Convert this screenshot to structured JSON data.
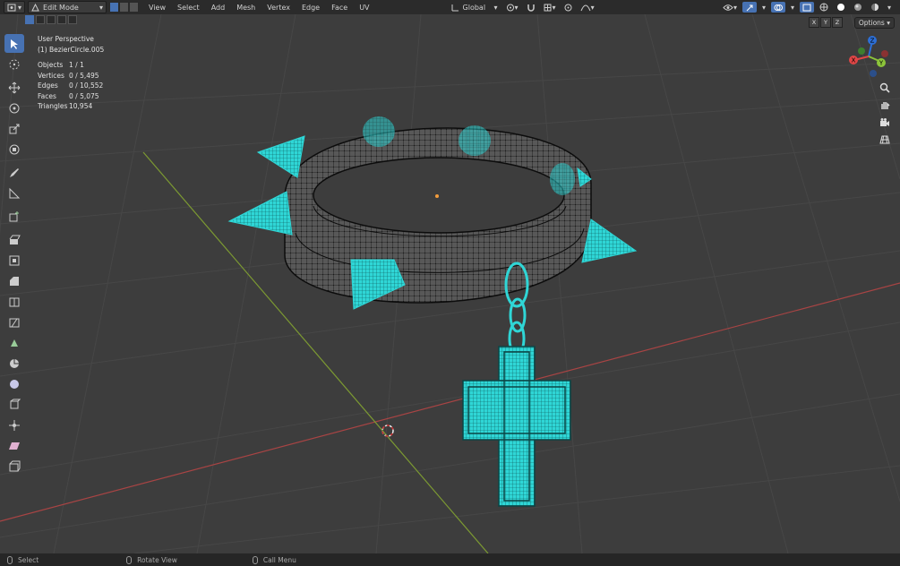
{
  "header": {
    "mode": "Edit Mode",
    "menus": [
      "View",
      "Select",
      "Add",
      "Mesh",
      "Vertex",
      "Edge",
      "Face",
      "UV"
    ],
    "orientation": "Global",
    "options_label": "Options"
  },
  "axes_buttons": [
    "X",
    "Y",
    "Z"
  ],
  "overlay_info": {
    "view_name": "User Perspective",
    "object_name": "(1) BezierCircle.005",
    "stats": [
      {
        "label": "Objects",
        "value": "1 / 1"
      },
      {
        "label": "Vertices",
        "value": "0 / 5,495"
      },
      {
        "label": "Edges",
        "value": "0 / 10,552"
      },
      {
        "label": "Faces",
        "value": "0 / 5,075"
      },
      {
        "label": "Triangles",
        "value": "10,954"
      }
    ]
  },
  "gizmo": {
    "x": "X",
    "y": "Y",
    "z": "Z"
  },
  "statusbar": {
    "select": "Select",
    "rotate": "Rotate View",
    "menu": "Call Menu"
  },
  "colors": {
    "accent": "#4772b3",
    "selected_mesh": "#2fd6d6",
    "wire": "#111111",
    "grid_x": "#a84444",
    "grid_y": "#7c9a32"
  }
}
